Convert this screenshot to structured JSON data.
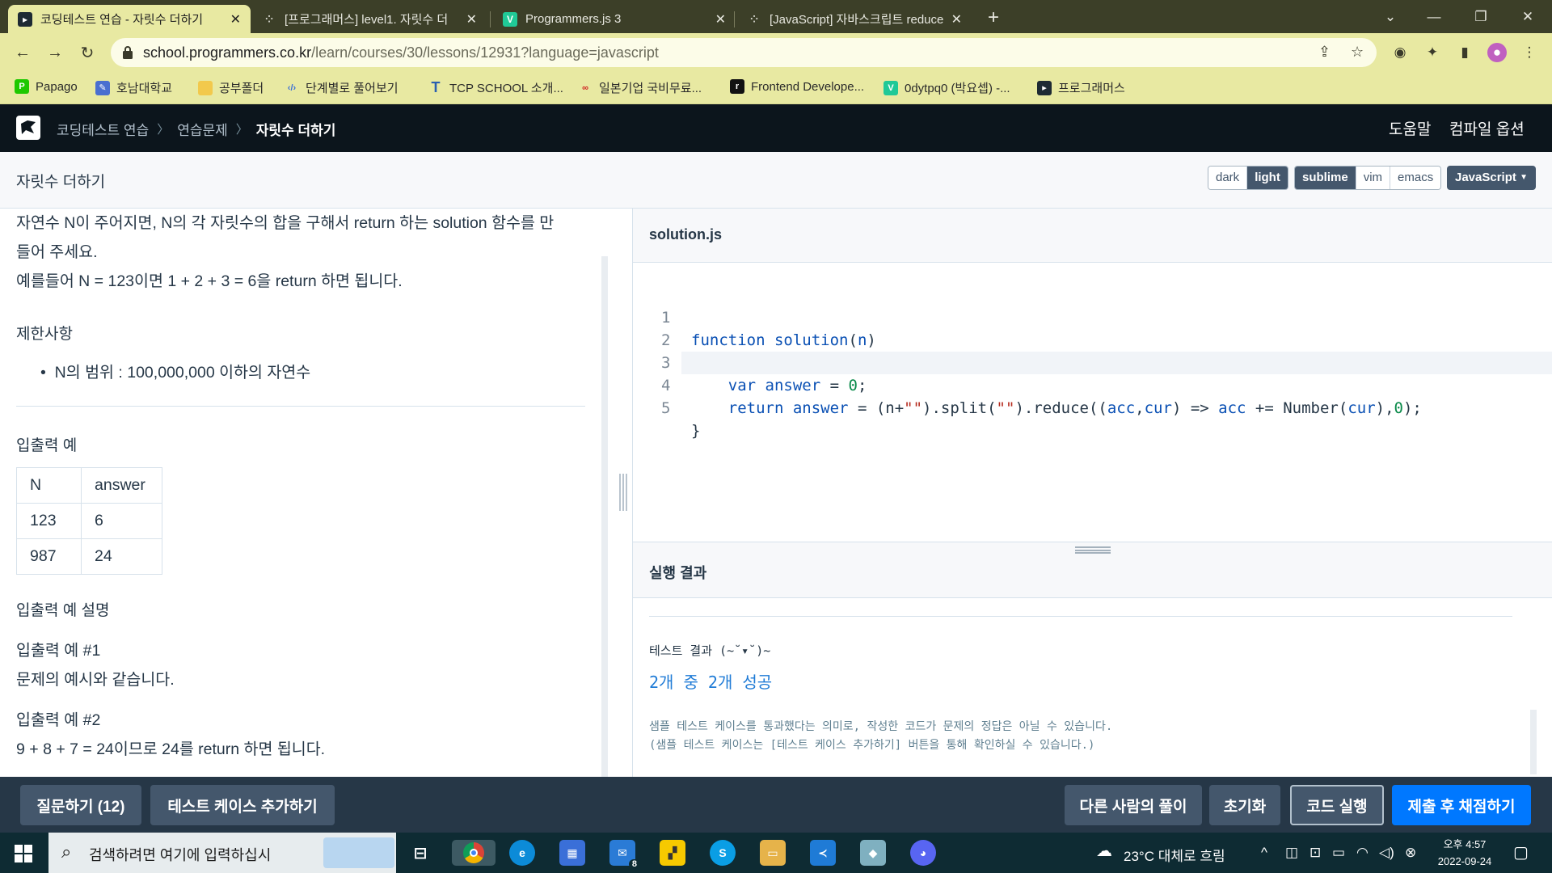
{
  "browser": {
    "tabs": [
      {
        "title": "코딩테스트 연습 - 자릿수 더하기",
        "active": true
      },
      {
        "title": "[프로그래머스] level1. 자릿수 더",
        "active": false
      },
      {
        "title": "Programmers.js 3",
        "active": false
      },
      {
        "title": "[JavaScript] 자바스크립트 reduce",
        "active": false
      }
    ],
    "url_host": "school.programmers.co.kr",
    "url_path": "/learn/courses/30/lessons/12931?language=javascript",
    "bookmarks": [
      "Papago",
      "호남대학교",
      "공부폴더",
      "단계별로 풀어보기",
      "TCP SCHOOL 소개...",
      "일본기업 국비무료...",
      "Frontend Develope...",
      "0dytpq0 (박요셉) -...",
      "프로그래머스"
    ]
  },
  "header": {
    "breadcrumbs": [
      "코딩테스트 연습",
      "연습문제",
      "자릿수 더하기"
    ],
    "help": "도움말",
    "compile_options": "컴파일 옵션"
  },
  "lesson": {
    "title": "자릿수 더하기",
    "themes": [
      "dark",
      "light"
    ],
    "active_theme": "light",
    "keymaps": [
      "sublime",
      "vim",
      "emacs"
    ],
    "active_keymap": "sublime",
    "language": "JavaScript"
  },
  "problem": {
    "desc_line1": "자연수 N이 주어지면, N의 각 자릿수의 합을 구해서 return 하는 solution 함수를 만",
    "desc_line2": "들어 주세요.",
    "desc_line3": "예를들어 N = 123이면 1 + 2 + 3 = 6을 return 하면 됩니다.",
    "limits_title": "제한사항",
    "limits": [
      "N의 범위 : 100,000,000 이하의 자연수"
    ],
    "io_title": "입출력 예",
    "io_headers": [
      "N",
      "answer"
    ],
    "io_rows": [
      [
        "123",
        "6"
      ],
      [
        "987",
        "24"
      ]
    ],
    "io_explain_title": "입출력 예 설명",
    "ex1_title": "입출력 예 #1",
    "ex1_body": "문제의 예시와 같습니다.",
    "ex2_title": "입출력 예 #2",
    "ex2_body": "9 + 8 + 7 = 24이므로 24를 return 하면 됩니다."
  },
  "editor": {
    "filename": "solution.js",
    "line_numbers": [
      "1",
      "2",
      "3",
      "4",
      "5"
    ]
  },
  "console": {
    "title": "실행 결과",
    "test_label": "테스트 결과 (~˘▾˘)~",
    "result": "2개 중 2개 성공",
    "note_line1": "샘플 테스트 케이스를 통과했다는 의미로, 작성한 코드가 문제의 정답은 아닐 수 있습니다.",
    "note_line2": "(샘플 테스트 케이스는 [테스트 케이스 추가하기] 버튼을 통해 확인하실 수 있습니다.)"
  },
  "footer": {
    "question": "질문하기 (12)",
    "add_testcase": "테스트 케이스 추가하기",
    "others": "다른 사람의 풀이",
    "reset": "초기화",
    "run": "코드 실행",
    "submit": "제출 후 채점하기"
  },
  "taskbar": {
    "search_placeholder": "검색하려면 여기에 입력하십시",
    "mail_badge": "8",
    "weather": "23°C  대체로 흐림",
    "time": "오후 4:57",
    "date": "2022-09-24"
  }
}
